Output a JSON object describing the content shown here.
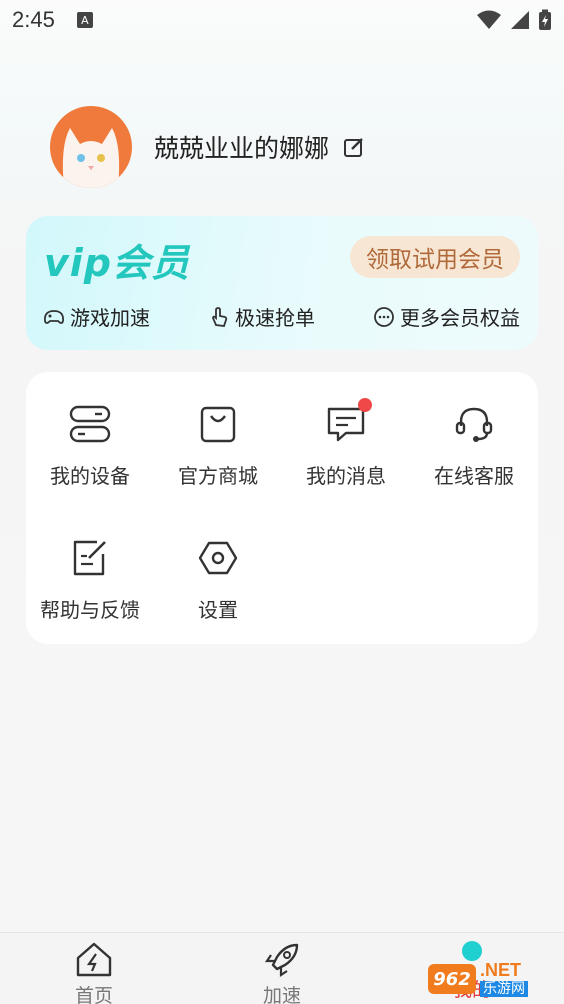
{
  "status": {
    "time": "2:45",
    "notif": "A"
  },
  "profile": {
    "username": "兢兢业业的娜娜"
  },
  "vip": {
    "title": "vip会员",
    "trial_button": "领取试用会员",
    "benefits": [
      "游戏加速",
      "极速抢单",
      "更多会员权益"
    ]
  },
  "menu": {
    "items": [
      "我的设备",
      "官方商城",
      "我的消息",
      "在线客服",
      "帮助与反馈",
      "设置"
    ]
  },
  "nav": {
    "items": [
      "首页",
      "加速",
      "我的"
    ]
  },
  "watermark": {
    "badge": "962",
    "net": ".NET",
    "sub": "乐游网"
  },
  "colors": {
    "accent": "#23c7bd",
    "trial_text": "#b06a3a",
    "trial_bg": "#f8e6d4",
    "badge_red": "#f04848",
    "nav_active": "#e03a3a"
  }
}
